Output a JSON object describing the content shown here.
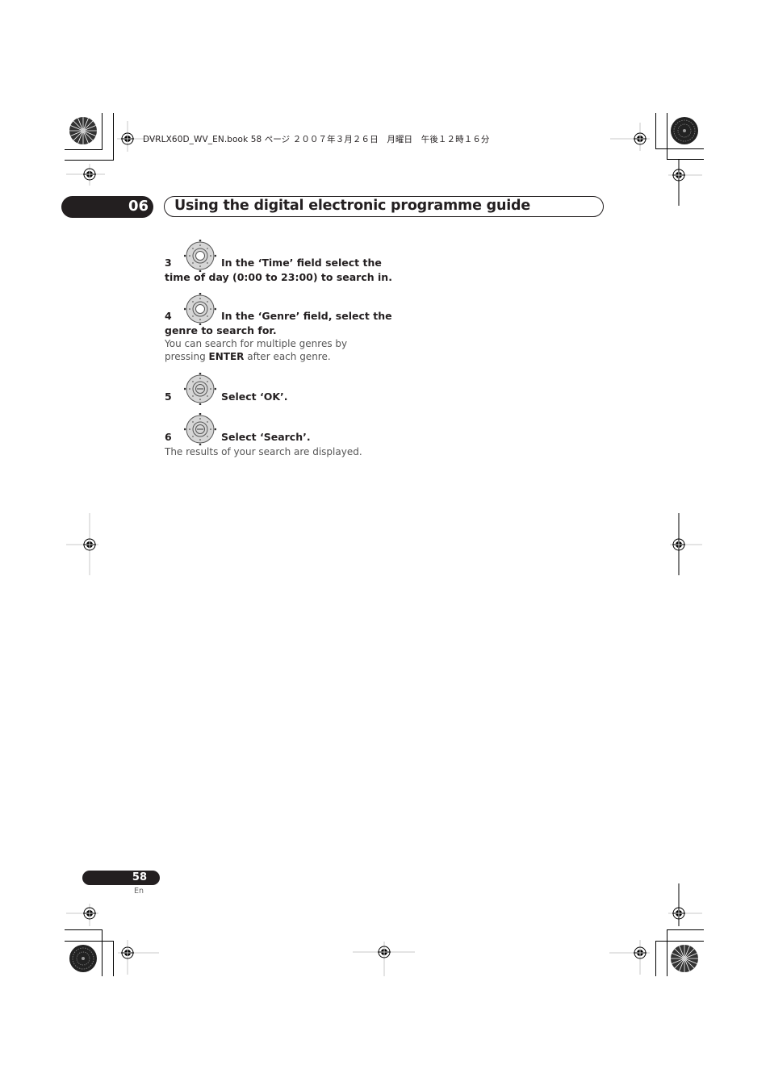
{
  "print_header": {
    "file_info": "DVRLX60D_WV_EN.book  58 ページ  ２００７年３月２６日　月曜日　午後１２時１６分"
  },
  "chapter": {
    "number": "06",
    "title": "Using the digital electronic programme guide"
  },
  "steps": [
    {
      "number": "3",
      "icon": "dpad-icon",
      "text_line1": "In the ‘Time’ field select the",
      "text_line2": "time of day (0:00 to 23:00) to search in."
    },
    {
      "number": "4",
      "icon": "dpad-icon",
      "text_line1": "In the ‘Genre’ field, select the",
      "text_line2": "genre to search for.",
      "note_pre": "You can search for multiple genres by pressing ",
      "note_bold": "ENTER",
      "note_post": " after each genre."
    },
    {
      "number": "5",
      "icon": "dpad-enter-icon",
      "text_line1": "Select ‘OK’."
    },
    {
      "number": "6",
      "icon": "dpad-enter-icon",
      "text_line1": "Select ‘Search’.",
      "note": "The results of your search are displayed."
    }
  ],
  "footer": {
    "page_number": "58",
    "language": "En"
  }
}
